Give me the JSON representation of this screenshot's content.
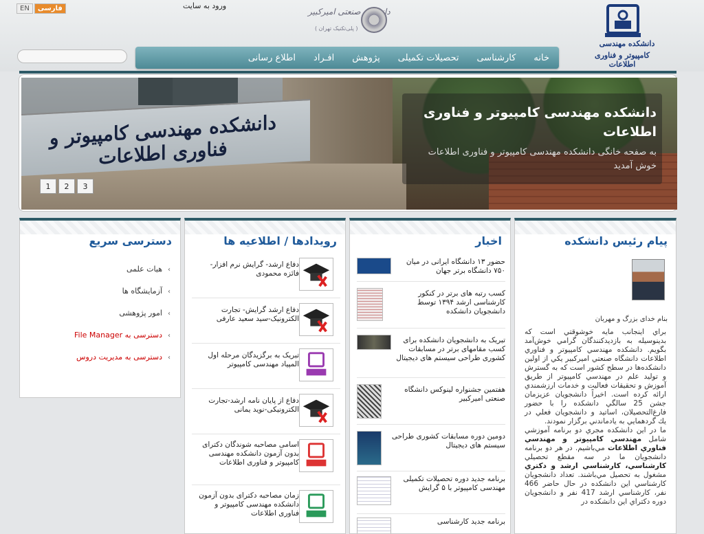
{
  "header": {
    "lang_en": "EN",
    "lang_fa": "فارسی",
    "login": "ورود به سایت",
    "aut_name": "دانشگاه صنعتی امیرکبیر",
    "aut_sub": "( پلی‌تکنیک تهران )",
    "logo_line1": "دانشکده مهندسی",
    "logo_line2": "کامپیوتر و فناوری اطلاعات",
    "search_placeholder": ""
  },
  "menu": [
    "خانه",
    "کارشناسی",
    "تحصیلات تکمیلی",
    "پژوهش",
    "افـراد",
    "اطلاع رسانی"
  ],
  "slider": {
    "sign_text": "دانشکده مهندسی کامپیوتر و فناوری اطلاعات",
    "title": "دانشکده مهندسی کامپیوتر و فناوری اطلاعات",
    "desc": "به صفحه خانگی دانشکده مهندسی کامپیوتر و فناوری اطلاعات خوش آمدید",
    "pages": [
      "1",
      "2",
      "3"
    ]
  },
  "president": {
    "title": "پیام رئیس دانشکده",
    "greeting": "بنام خدای بزرگ و مهربان",
    "p1": "براي اينجانب مايه خوشوقتي است كه بدينوسيله به بازديدكنندگان گرامي خوش‌آمد بگويم. دانشكده مهندسي كامپيوتر و فناوري اطلاعات دانشگاه صنعتي اميركبير يكي از اولين دانشكده‌ها در سطح كشور است كه به گسترش و توليد علم در مهندسي كامپيوتر از طريق آموزش و تحقيقات فعاليت و خدمات ارزشمندي ارائه كرده است. اخيراً دانشجويان عزيزمان جشن 25 سالگي دانشكده را با حضور فارغ‌التحصيلان، اساتيد و دانشجويان فعلي در يك گردهمايي به يادماندني برگزار نمودند.",
    "p2_a": "ما در اين دانشكده مجري دو برنامه آموزشي شامل ",
    "p2_b": "مهندسي كامپيوتر و مهندسي فناوري اطلاعات",
    "p2_c": " مي‌باشيم. در هر دو برنامه دانشجويان ما در سه مقطع تحصيلي ",
    "p2_d": "كارشناسي، كارشناسي ارشد و دكتري",
    "p2_e": " مشغول به تحصيل مي‌باشند. تعداد دانشجويان كارشناسي اين دانشكده در حال حاضر 466 نفر، كارشناسي ارشد 417 نفر و دانشجويان دوره دكتراي اين دانشكده در"
  },
  "news": {
    "title": "اخبار",
    "items": [
      {
        "text": "حضور ۱۳ دانشگاه ایرانی در میان ۷۵۰ دانشگاه برتر جهان",
        "thumb": "cwts-logo"
      },
      {
        "text": "کسب رتبه های برتر در کنکور کارشناسی ارشد ۱۳۹۴ توسط دانشجویان دانشکده",
        "thumb": "exam-sheet"
      },
      {
        "text": "تبریک به دانشجویان دانشکده برای کسب مقامهای برتر در مسابقات کشوری طراحی سیستم های دیجیتال",
        "thumb": "group-photo"
      },
      {
        "text": "هفتمین جشنواره لینوکس دانشگاه صنعتی امیرکبیر",
        "thumb": "poster"
      },
      {
        "text": "دومین دوره مسابقات کشوری طراحی سیستم های دیجیتال",
        "thumb": "poster-blue"
      },
      {
        "text": "برنامه جدید دوره تحصیلات تکمیلی مهندسی کامپیوتر با ۵ گرایش",
        "thumb": "document"
      },
      {
        "text": "برنامه جدید کارشناسی",
        "thumb": "document"
      }
    ]
  },
  "events": {
    "title": "رویدادها / اطلاعیه ها",
    "items": [
      {
        "text": "دفاع ارشد- گرایش نرم افزار-فائزه محمودی",
        "icon": "graduation-cap-icon"
      },
      {
        "text": "دفاع ارشد گرایش- تجارت الکترونیک-سید سعید عارفی",
        "icon": "graduation-cap-icon"
      },
      {
        "text": "تبریک به برگزیدگان مرحله اول المپیاد مهندسی کامپیوتر",
        "icon": "faculty-logo-purple-icon"
      },
      {
        "text": "دفاع از پایان نامه ارشد-تجارت الکترونیکی-نوید یمانی",
        "icon": "graduation-cap-icon"
      },
      {
        "text": "اسامی مصاحبه شوندگان دکترای بدون آزمون دانشکده مهندسی کامپیوتر و فناوری اطلاعات",
        "icon": "faculty-logo-red-icon"
      },
      {
        "text": "زمان مصاحبه دکترای بدون آزمون دانشکده مهندسی کامپیوتر و فناوری اطلاعات",
        "icon": "faculty-logo-green-icon"
      }
    ]
  },
  "quick": {
    "title": "دسترسی سریع",
    "items": [
      {
        "text": "هیات علمی",
        "red": false
      },
      {
        "text": "آزمایشگاه ها",
        "red": false
      },
      {
        "text": "امور پژوهشی",
        "red": false
      },
      {
        "text": "دسترسی به File Manager",
        "red": true
      },
      {
        "text": "دسترسی به مدیریت دروس",
        "red": true
      }
    ]
  },
  "colors": {
    "menu": "#5a96a2",
    "title_blue": "#1f5a9a",
    "accent_orange": "#e88b2c"
  }
}
